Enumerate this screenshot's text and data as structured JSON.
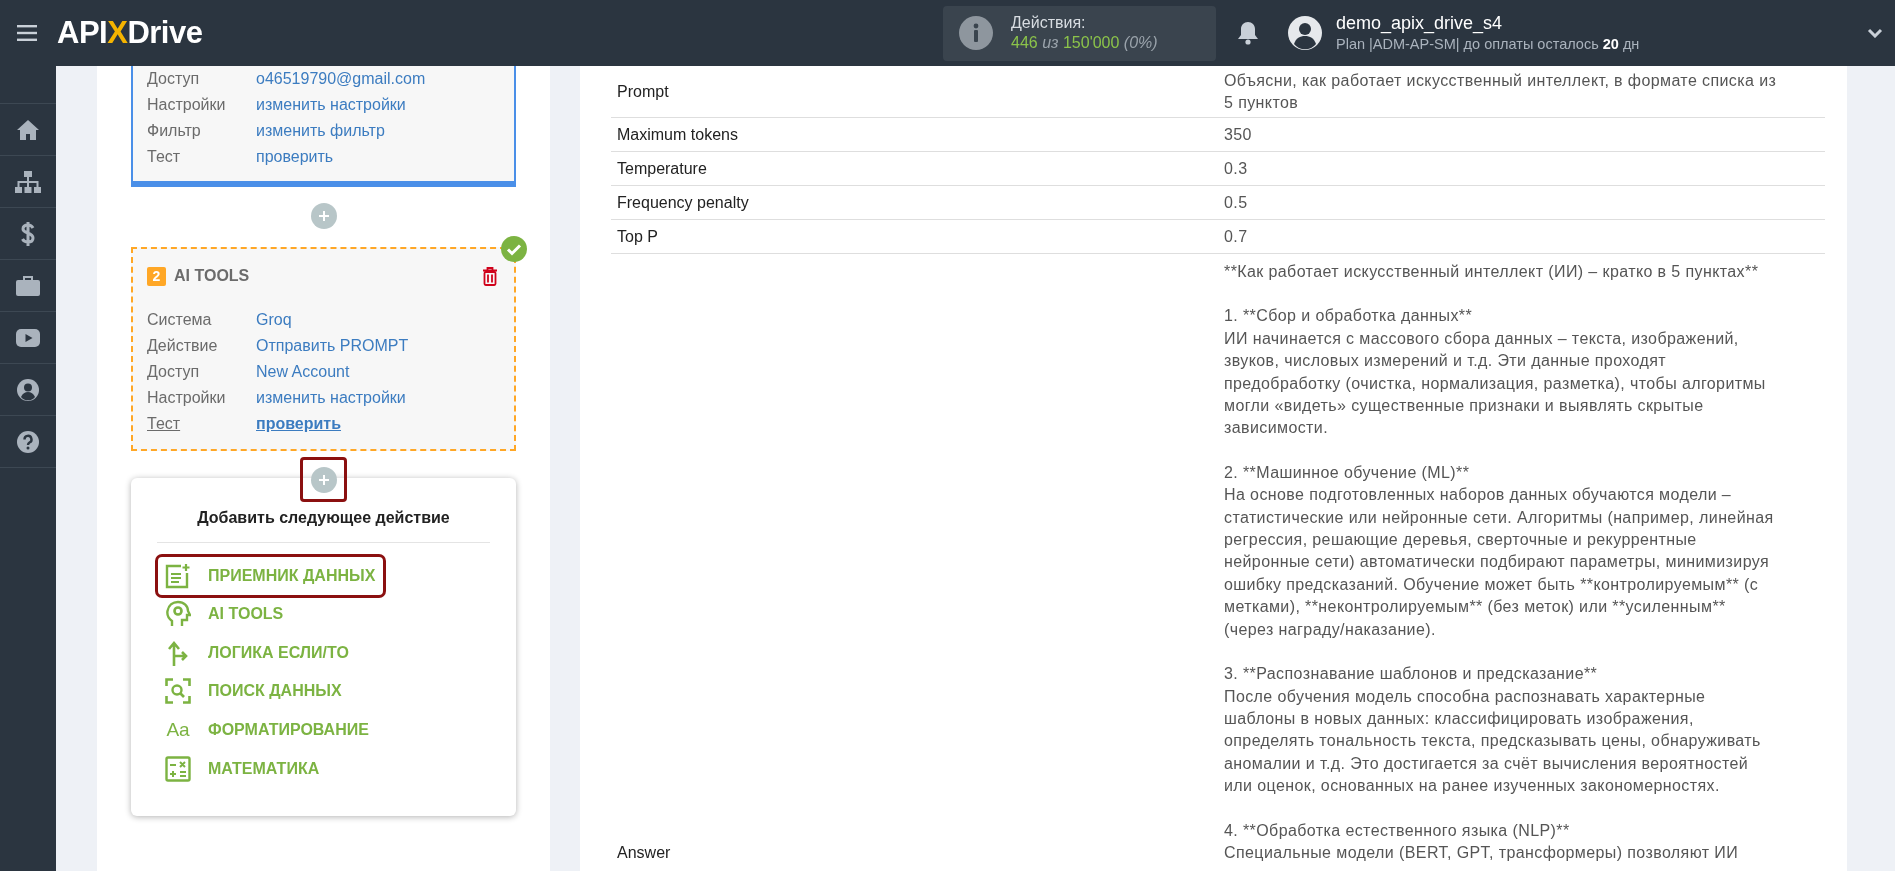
{
  "header": {
    "logo": {
      "part_1": "API",
      "part_2": "X",
      "part_3": "Drive"
    },
    "actions": {
      "label": "Действия:",
      "used": "446",
      "of": "из",
      "total": "150'000",
      "percent": "(0%)"
    },
    "user": {
      "name": "demo_apix_drive_s4",
      "plan": "Plan |ADM-AP-SM| до оплаты осталось **20** дн"
    }
  },
  "sidebar": {
    "items": [
      {
        "kind": "home"
      },
      {
        "kind": "sitemap"
      },
      {
        "kind": "dollar"
      },
      {
        "kind": "briefcase"
      },
      {
        "kind": "video"
      },
      {
        "kind": "user"
      },
      {
        "kind": "help"
      }
    ]
  },
  "source_card": {
    "rows": [
      {
        "label": "Доступ",
        "value": "o46519790@gmail.com",
        "highlighted": false
      },
      {
        "label": "Настройки",
        "value": "изменить настройки",
        "highlighted": false
      },
      {
        "label": "Фильтр",
        "value": "изменить фильтр",
        "highlighted": false
      },
      {
        "label": "Тест",
        "value": "проверить",
        "highlighted": false
      }
    ]
  },
  "ai_card": {
    "number": "2",
    "title": "AI TOOLS",
    "done": true,
    "rows": [
      {
        "label": "Система",
        "value": "Groq",
        "highlighted": false
      },
      {
        "label": "Действие",
        "value": "Отправить PROMPT",
        "highlighted": false
      },
      {
        "label": "Доступ",
        "value": "New Account",
        "highlighted": false
      },
      {
        "label": "Настройки",
        "value": "изменить настройки",
        "highlighted": false
      },
      {
        "label": "Тест",
        "value": "проверить",
        "highlighted": true
      }
    ]
  },
  "add_menu": {
    "title": "Добавить следующее действие",
    "plus_highlighted": true,
    "items": [
      {
        "kind": "receiver",
        "label": "ПРИЕМНИК ДАННЫХ",
        "selected": true
      },
      {
        "kind": "ai",
        "label": "AI TOOLS",
        "selected": false
      },
      {
        "kind": "logic",
        "label": "ЛОГИКА ЕСЛИ/ТО",
        "selected": false
      },
      {
        "kind": "search",
        "label": "ПОИСК ДАННЫХ",
        "selected": false
      },
      {
        "kind": "format",
        "icon": "Aa",
        "label": "ФОРМАТИРОВАНИЕ",
        "selected": false
      },
      {
        "kind": "math",
        "label": "МАТЕМАТИКА",
        "selected": false
      }
    ]
  },
  "table": {
    "rows": [
      {
        "label": "Prompt",
        "value": "Объясни, как работает искусственный интеллект, в формате списка из 5 пунктов"
      },
      {
        "label": "Maximum tokens",
        "value": "350"
      },
      {
        "label": "Temperature",
        "value": "0.3"
      },
      {
        "label": "Frequency penalty",
        "value": "0.5"
      },
      {
        "label": "Top P",
        "value": "0.7"
      }
    ],
    "answer": {
      "label": "Answer",
      "paragraphs": [
        "**Как работает искусственный интеллект (ИИ) – кратко в 5 пунктах**",
        "1. **Сбор и обработка данных**\nИИ начинается с массового сбора данных – текста, изображений, звуков, числовых измерений и т.д. Эти данные проходят предобработку (очистка, нормализация, разметка), чтобы алгоритмы могли «видеть» существенные признаки и выявлять скрытые зависимости.",
        "2. **Машинное обучение (ML)**\nНа основе подготовленных наборов данных обучаются модели – статистические или нейронные сети. Алгоритмы (например, линейная регрессия, решающие деревья, сверточные и рекуррентные нейронные сети) автоматически подбирают параметры, минимизируя ошибку предсказаний. Обучение может быть **контролируемым** (с метками), **неконтролируемым** (без меток) или **усиленным** (через награду/наказание).",
        "3. **Распознавание шаблонов и предсказание**\nПосле обучения модель способна распознавать характерные шаблоны в новых данных: классифицировать изображения, определять тональность текста, предсказывать цены, обнаруживать аномалии и т.д. Это достигается за счёт вычисления вероятностей или оценок, основанных на ранее изученных закономерностях.",
        "4. **Обработка естественного языка (NLP)**\nСпециальные модели (BERT, GPT, трансформеры) позволяют ИИ"
      ]
    }
  }
}
